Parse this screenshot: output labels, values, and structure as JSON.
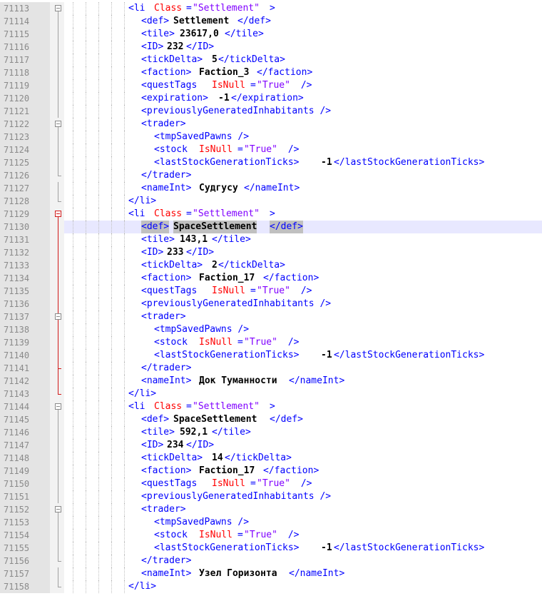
{
  "colors": {
    "tag": "#0000ff",
    "attribute": "#ff0000",
    "attribute_value": "#8000ff",
    "text": "#000000",
    "gutter_background": "#e4e4e4",
    "line_number": "#8a8a8a",
    "fold_marker_active": "#d11a1a",
    "current_line_background": "#e8e8ff",
    "match_highlight": "#c0c0c0"
  },
  "current_line": "71130",
  "lines": [
    {
      "num": "71113",
      "indent": 1,
      "fold": "open",
      "frags": [
        {
          "k": "t",
          "s": "<li "
        },
        {
          "k": "a",
          "s": "Class"
        },
        {
          "k": "t",
          "s": "="
        },
        {
          "k": "v",
          "s": "\"Settlement\""
        },
        {
          "k": "t",
          "s": ">"
        }
      ]
    },
    {
      "num": "71114",
      "indent": 2,
      "fold": "line",
      "frags": [
        {
          "k": "t",
          "s": "<def>"
        },
        {
          "k": "x",
          "s": "Settlement"
        },
        {
          "k": "t",
          "s": "</def>"
        }
      ]
    },
    {
      "num": "71115",
      "indent": 2,
      "fold": "line",
      "frags": [
        {
          "k": "t",
          "s": "<tile>"
        },
        {
          "k": "x",
          "s": "23617,0"
        },
        {
          "k": "t",
          "s": "</tile>"
        }
      ]
    },
    {
      "num": "71116",
      "indent": 2,
      "fold": "line",
      "frags": [
        {
          "k": "t",
          "s": "<ID>"
        },
        {
          "k": "x",
          "s": "232"
        },
        {
          "k": "t",
          "s": "</ID>"
        }
      ]
    },
    {
      "num": "71117",
      "indent": 2,
      "fold": "line",
      "frags": [
        {
          "k": "t",
          "s": "<tickDelta>"
        },
        {
          "k": "x",
          "s": "5"
        },
        {
          "k": "t",
          "s": "</tickDelta>"
        }
      ]
    },
    {
      "num": "71118",
      "indent": 2,
      "fold": "line",
      "frags": [
        {
          "k": "t",
          "s": "<faction>"
        },
        {
          "k": "x",
          "s": "Faction_3"
        },
        {
          "k": "t",
          "s": "</faction>"
        }
      ]
    },
    {
      "num": "71119",
      "indent": 2,
      "fold": "line",
      "frags": [
        {
          "k": "t",
          "s": "<questTags "
        },
        {
          "k": "a",
          "s": "IsNull"
        },
        {
          "k": "t",
          "s": "="
        },
        {
          "k": "v",
          "s": "\"True\""
        },
        {
          "k": "t",
          "s": " />"
        }
      ]
    },
    {
      "num": "71120",
      "indent": 2,
      "fold": "line",
      "frags": [
        {
          "k": "t",
          "s": "<expiration>"
        },
        {
          "k": "x",
          "s": "-1"
        },
        {
          "k": "t",
          "s": "</expiration>"
        }
      ]
    },
    {
      "num": "71121",
      "indent": 2,
      "fold": "line",
      "frags": [
        {
          "k": "t",
          "s": "<previouslyGeneratedInhabitants />"
        }
      ]
    },
    {
      "num": "71122",
      "indent": 2,
      "fold": "open",
      "frags": [
        {
          "k": "t",
          "s": "<trader>"
        }
      ]
    },
    {
      "num": "71123",
      "indent": 3,
      "fold": "line",
      "frags": [
        {
          "k": "t",
          "s": "<tmpSavedPawns />"
        }
      ]
    },
    {
      "num": "71124",
      "indent": 3,
      "fold": "line",
      "frags": [
        {
          "k": "t",
          "s": "<stock "
        },
        {
          "k": "a",
          "s": "IsNull"
        },
        {
          "k": "t",
          "s": "="
        },
        {
          "k": "v",
          "s": "\"True\""
        },
        {
          "k": "t",
          "s": " />"
        }
      ]
    },
    {
      "num": "71125",
      "indent": 3,
      "fold": "line",
      "frags": [
        {
          "k": "t",
          "s": "<lastStockGenerationTicks>"
        },
        {
          "k": "x",
          "s": "-1"
        },
        {
          "k": "t",
          "s": "</lastStockGenerationTicks>"
        }
      ]
    },
    {
      "num": "71126",
      "indent": 2,
      "fold": "end",
      "frags": [
        {
          "k": "t",
          "s": "</trader>"
        }
      ]
    },
    {
      "num": "71127",
      "indent": 2,
      "fold": "line",
      "frags": [
        {
          "k": "t",
          "s": "<nameInt>"
        },
        {
          "k": "x",
          "s": "Судгусу"
        },
        {
          "k": "t",
          "s": "</nameInt>"
        }
      ]
    },
    {
      "num": "71128",
      "indent": 1,
      "fold": "end",
      "frags": [
        {
          "k": "t",
          "s": "</li>"
        }
      ]
    },
    {
      "num": "71129",
      "indent": 1,
      "fold": "open-red",
      "frags": [
        {
          "k": "t",
          "s": "<li "
        },
        {
          "k": "a",
          "s": "Class"
        },
        {
          "k": "t",
          "s": "="
        },
        {
          "k": "v",
          "s": "\"Settlement\""
        },
        {
          "k": "t",
          "s": ">"
        }
      ]
    },
    {
      "num": "71130",
      "indent": 2,
      "fold": "line-red",
      "frags": [
        {
          "k": "t",
          "s": "<def>",
          "hl": true
        },
        {
          "k": "x",
          "s": "SpaceSettlement",
          "hl": true
        },
        {
          "k": "t",
          "s": "</def>",
          "hl": true
        }
      ]
    },
    {
      "num": "71131",
      "indent": 2,
      "fold": "line-red",
      "frags": [
        {
          "k": "t",
          "s": "<tile>"
        },
        {
          "k": "x",
          "s": "143,1"
        },
        {
          "k": "t",
          "s": "</tile>"
        }
      ]
    },
    {
      "num": "71132",
      "indent": 2,
      "fold": "line-red",
      "frags": [
        {
          "k": "t",
          "s": "<ID>"
        },
        {
          "k": "x",
          "s": "233"
        },
        {
          "k": "t",
          "s": "</ID>"
        }
      ]
    },
    {
      "num": "71133",
      "indent": 2,
      "fold": "line-red",
      "frags": [
        {
          "k": "t",
          "s": "<tickDelta>"
        },
        {
          "k": "x",
          "s": "2"
        },
        {
          "k": "t",
          "s": "</tickDelta>"
        }
      ]
    },
    {
      "num": "71134",
      "indent": 2,
      "fold": "line-red",
      "frags": [
        {
          "k": "t",
          "s": "<faction>"
        },
        {
          "k": "x",
          "s": "Faction_17"
        },
        {
          "k": "t",
          "s": "</faction>"
        }
      ]
    },
    {
      "num": "71135",
      "indent": 2,
      "fold": "line-red",
      "frags": [
        {
          "k": "t",
          "s": "<questTags "
        },
        {
          "k": "a",
          "s": "IsNull"
        },
        {
          "k": "t",
          "s": "="
        },
        {
          "k": "v",
          "s": "\"True\""
        },
        {
          "k": "t",
          "s": " />"
        }
      ]
    },
    {
      "num": "71136",
      "indent": 2,
      "fold": "line-red",
      "frags": [
        {
          "k": "t",
          "s": "<previouslyGeneratedInhabitants />"
        }
      ]
    },
    {
      "num": "71137",
      "indent": 2,
      "fold": "open-in-red",
      "frags": [
        {
          "k": "t",
          "s": "<trader>"
        }
      ]
    },
    {
      "num": "71138",
      "indent": 3,
      "fold": "line-red",
      "frags": [
        {
          "k": "t",
          "s": "<tmpSavedPawns />"
        }
      ]
    },
    {
      "num": "71139",
      "indent": 3,
      "fold": "line-red",
      "frags": [
        {
          "k": "t",
          "s": "<stock "
        },
        {
          "k": "a",
          "s": "IsNull"
        },
        {
          "k": "t",
          "s": "="
        },
        {
          "k": "v",
          "s": "\"True\""
        },
        {
          "k": "t",
          "s": " />"
        }
      ]
    },
    {
      "num": "71140",
      "indent": 3,
      "fold": "line-red",
      "frags": [
        {
          "k": "t",
          "s": "<lastStockGenerationTicks>"
        },
        {
          "k": "x",
          "s": "-1"
        },
        {
          "k": "t",
          "s": "</lastStockGenerationTicks>"
        }
      ]
    },
    {
      "num": "71141",
      "indent": 2,
      "fold": "end-in-red",
      "frags": [
        {
          "k": "t",
          "s": "</trader>"
        }
      ]
    },
    {
      "num": "71142",
      "indent": 2,
      "fold": "line-red",
      "frags": [
        {
          "k": "t",
          "s": "<nameInt>"
        },
        {
          "k": "x",
          "s": "Док Туманности"
        },
        {
          "k": "t",
          "s": "</nameInt>"
        }
      ]
    },
    {
      "num": "71143",
      "indent": 1,
      "fold": "end-red",
      "frags": [
        {
          "k": "t",
          "s": "</li>"
        }
      ]
    },
    {
      "num": "71144",
      "indent": 1,
      "fold": "open",
      "frags": [
        {
          "k": "t",
          "s": "<li "
        },
        {
          "k": "a",
          "s": "Class"
        },
        {
          "k": "t",
          "s": "="
        },
        {
          "k": "v",
          "s": "\"Settlement\""
        },
        {
          "k": "t",
          "s": ">"
        }
      ]
    },
    {
      "num": "71145",
      "indent": 2,
      "fold": "line",
      "frags": [
        {
          "k": "t",
          "s": "<def>"
        },
        {
          "k": "x",
          "s": "SpaceSettlement"
        },
        {
          "k": "t",
          "s": "</def>"
        }
      ]
    },
    {
      "num": "71146",
      "indent": 2,
      "fold": "line",
      "frags": [
        {
          "k": "t",
          "s": "<tile>"
        },
        {
          "k": "x",
          "s": "592,1"
        },
        {
          "k": "t",
          "s": "</tile>"
        }
      ]
    },
    {
      "num": "71147",
      "indent": 2,
      "fold": "line",
      "frags": [
        {
          "k": "t",
          "s": "<ID>"
        },
        {
          "k": "x",
          "s": "234"
        },
        {
          "k": "t",
          "s": "</ID>"
        }
      ]
    },
    {
      "num": "71148",
      "indent": 2,
      "fold": "line",
      "frags": [
        {
          "k": "t",
          "s": "<tickDelta>"
        },
        {
          "k": "x",
          "s": "14"
        },
        {
          "k": "t",
          "s": "</tickDelta>"
        }
      ]
    },
    {
      "num": "71149",
      "indent": 2,
      "fold": "line",
      "frags": [
        {
          "k": "t",
          "s": "<faction>"
        },
        {
          "k": "x",
          "s": "Faction_17"
        },
        {
          "k": "t",
          "s": "</faction>"
        }
      ]
    },
    {
      "num": "71150",
      "indent": 2,
      "fold": "line",
      "frags": [
        {
          "k": "t",
          "s": "<questTags "
        },
        {
          "k": "a",
          "s": "IsNull"
        },
        {
          "k": "t",
          "s": "="
        },
        {
          "k": "v",
          "s": "\"True\""
        },
        {
          "k": "t",
          "s": " />"
        }
      ]
    },
    {
      "num": "71151",
      "indent": 2,
      "fold": "line",
      "frags": [
        {
          "k": "t",
          "s": "<previouslyGeneratedInhabitants />"
        }
      ]
    },
    {
      "num": "71152",
      "indent": 2,
      "fold": "open",
      "frags": [
        {
          "k": "t",
          "s": "<trader>"
        }
      ]
    },
    {
      "num": "71153",
      "indent": 3,
      "fold": "line",
      "frags": [
        {
          "k": "t",
          "s": "<tmpSavedPawns />"
        }
      ]
    },
    {
      "num": "71154",
      "indent": 3,
      "fold": "line",
      "frags": [
        {
          "k": "t",
          "s": "<stock "
        },
        {
          "k": "a",
          "s": "IsNull"
        },
        {
          "k": "t",
          "s": "="
        },
        {
          "k": "v",
          "s": "\"True\""
        },
        {
          "k": "t",
          "s": " />"
        }
      ]
    },
    {
      "num": "71155",
      "indent": 3,
      "fold": "line",
      "frags": [
        {
          "k": "t",
          "s": "<lastStockGenerationTicks>"
        },
        {
          "k": "x",
          "s": "-1"
        },
        {
          "k": "t",
          "s": "</lastStockGenerationTicks>"
        }
      ]
    },
    {
      "num": "71156",
      "indent": 2,
      "fold": "end",
      "frags": [
        {
          "k": "t",
          "s": "</trader>"
        }
      ]
    },
    {
      "num": "71157",
      "indent": 2,
      "fold": "line",
      "frags": [
        {
          "k": "t",
          "s": "<nameInt>"
        },
        {
          "k": "x",
          "s": "Узел Горизонта"
        },
        {
          "k": "t",
          "s": "</nameInt>"
        }
      ]
    },
    {
      "num": "71158",
      "indent": 1,
      "fold": "end",
      "frags": [
        {
          "k": "t",
          "s": "</li>"
        }
      ]
    }
  ]
}
